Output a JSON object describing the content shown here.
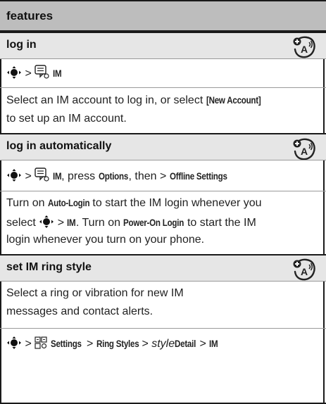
{
  "header": {
    "title": "features"
  },
  "sections": [
    {
      "title": "log in",
      "path": {
        "gt": ">",
        "im": "IM"
      },
      "desc": {
        "part1": "Select an IM account to log in, or select ",
        "new_account": "[New Account]",
        "part2": "to set up an IM account."
      }
    },
    {
      "title": "log in automatically",
      "path": {
        "gt1": ">",
        "im": "IM",
        "press": ", press ",
        "options": "Options",
        "then": ", then > ",
        "offline": "Offline Settings"
      },
      "desc": {
        "l1_pre": "Turn on ",
        "auto_login": "Auto-Login",
        "l1_post": " to start the IM login whenever you",
        "l2_pre": "select ",
        "l2_gt": " > ",
        "l2_im": "IM",
        "l2_mid": ". Turn on ",
        "power_on": "Power-On Login",
        "l2_post": " to start the IM",
        "l3": "login whenever you turn on your phone."
      }
    },
    {
      "title": "set IM ring style",
      "desc": {
        "l1": "Select a ring or vibration for new IM",
        "l2": "messages and contact alerts."
      },
      "path": {
        "gt1": " > ",
        "settings": "Settings",
        "gt2": " > ",
        "ring_styles": "Ring Styles",
        "gt3": " > ",
        "style": "style",
        "detail": " Detail",
        "gt4": " > ",
        "im": "IM"
      }
    }
  ],
  "badge_icon": "network-feature-icon",
  "nav_icon": "nav-key-icon",
  "message_icon": "message-icon",
  "settings_icon": "settings-icon",
  "colors": {
    "header_bg": "#bdbdbd",
    "section_bg": "#e6e6e6",
    "border": "#1a1a1a"
  }
}
